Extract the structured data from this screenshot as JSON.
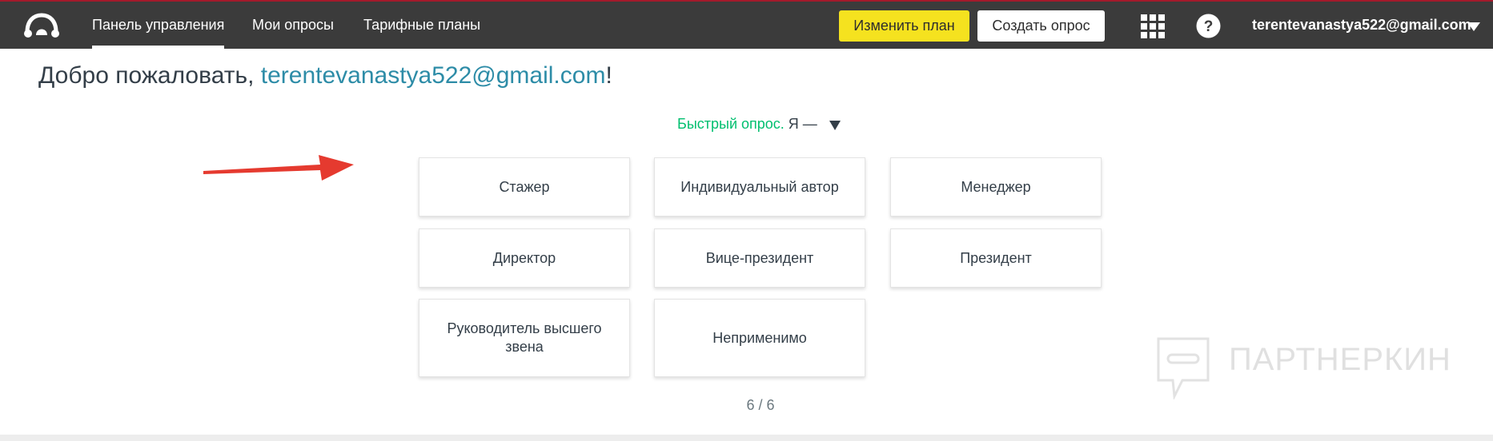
{
  "header": {
    "nav": [
      {
        "label": "Панель управления",
        "active": true
      },
      {
        "label": "Мои опросы",
        "active": false
      },
      {
        "label": "Тарифные планы",
        "active": false
      }
    ],
    "upgrade_label": "Изменить план",
    "create_label": "Создать опрос",
    "account_email": "terentevanastya522@gmail.com"
  },
  "welcome": {
    "prefix": "Добро пожаловать, ",
    "email": "terentevanastya522@gmail.com",
    "suffix": "!"
  },
  "quick_survey": {
    "label": "Быстрый опрос.",
    "question": " Я —"
  },
  "options": [
    "Стажер",
    "Индивидуальный автор",
    "Менеджер",
    "Директор",
    "Вице-президент",
    "Президент",
    "Руководитель высшего звена",
    "Неприменимо"
  ],
  "pager": "6 / 6",
  "watermark": "ПАРТНЕРКИН",
  "colors": {
    "topbar": "#3b3b3b",
    "upgrade_button": "#f5e21f",
    "link": "#2d8ca7",
    "accent_green": "#00bf6f",
    "arrow": "#e53a2f"
  }
}
